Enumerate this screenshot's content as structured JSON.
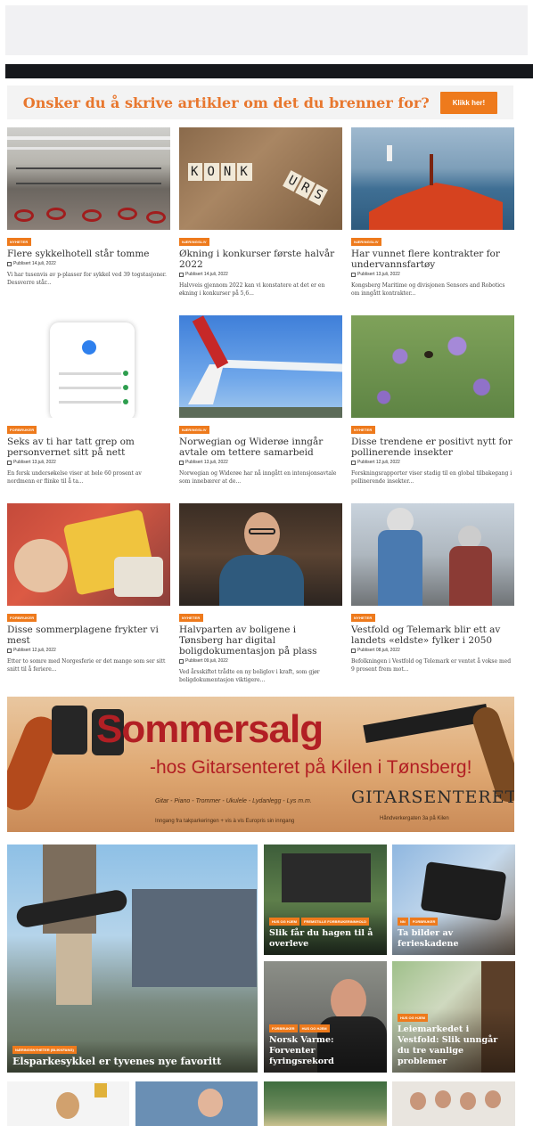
{
  "banner": {
    "text": "Onsker du å skrive artikler om det du brenner for?",
    "button": "Klikk her!"
  },
  "articles": [
    {
      "tag": "NYHETER",
      "title": "Flere sykkelhotell står tomme",
      "date": "Publisert 14.juli, 2022",
      "excerpt": "Vi har tusenvis av p-plasser for sykkel ved 39 togstasjoner. Dessverre står..."
    },
    {
      "tag": "NÆRINGSLIV",
      "title": "Økning i konkurser første halvår 2022",
      "date": "Publisert 14.juli, 2022",
      "excerpt": "Halvveis gjennom 2022 kan vi konstatere at det er en økning i konkurser på 5,6..."
    },
    {
      "tag": "NÆRINGSLIV",
      "title": "Har vunnet flere kontrakter for undervannsfartøy",
      "date": "Publisert 13.juli, 2022",
      "excerpt": "Kongsberg Maritime og divisjonen Sensors and Robotics om inngått kontrakter..."
    },
    {
      "tag": "FORBRUKER",
      "title": "Seks av ti har tatt grep om personvernet sitt på nett",
      "date": "Publisert 13.juli, 2022",
      "excerpt": "En fersk undersøkelse viser at hele 60 prosent av nordmenn er flinke til å ta..."
    },
    {
      "tag": "NÆRINGSLIV",
      "title": "Norwegian og Widerøe inngår avtale om tettere samarbeid",
      "date": "Publisert 13.juli, 2022",
      "excerpt": "Norwegian og Widerøe har nå inngått en intensjonsavtale som innebærer at de..."
    },
    {
      "tag": "NYHETER",
      "title": "Disse trendene er positivt nytt for pollinerende insekter",
      "date": "Publisert 12.juli, 2022",
      "excerpt": "Forskningsrapporter viser stadig til en global tilbakegang i pollinerende insekter..."
    },
    {
      "tag": "FORBRUKER",
      "title": "Disse sommerplagene frykter vi mest",
      "date": "Publisert 12.juli, 2022",
      "excerpt": "Etter to somre med Norgesferie er det mange som ser sitt snitt til å feriere..."
    },
    {
      "tag": "NYHETER",
      "title": "Halvparten av boligene i Tønsberg har digital boligdokumentasjon på plass",
      "date": "Publisert 09.juli, 2022",
      "excerpt": "Ved årsskiftet trådte en ny boliglov i kraft, som gjør boligdokumentasjon viktigere..."
    },
    {
      "tag": "NYHETER",
      "title": "Vestfold og Telemark blir ett av landets «eldste» fylker i 2050",
      "date": "Publisert 08.juli, 2022",
      "excerpt": "Befolkningen i Vestfold og Telemark er ventet å vokse med 9 prosent frem mot..."
    }
  ],
  "ad": {
    "title": "Sommersalg",
    "subtitle": "-hos Gitarsenteret på Kilen i Tønsberg!",
    "items": "Gitar - Piano - Trommer - Ukulele - Lydanlegg - Lys m.m.",
    "note": "Inngang fra takparkeringen + vis à vis Europris sin inngang",
    "logo": "GITARSENTERET",
    "address": "Håndverkergaten 3a på Kilen"
  },
  "featured": [
    {
      "tags": [
        "NÆRINGSNYHETER (BLIKKFANG)"
      ],
      "title": "Elsparkesykkel er tyvenes nye favoritt"
    },
    {
      "tags": [
        "HUS OG HJEM",
        "FREMSTILLE FORBRUKERINNHOLD"
      ],
      "title": "Slik får du hagen til å overleve"
    },
    {
      "tags": [
        "NN",
        "FORBRUKER"
      ],
      "title": "Ta bilder av ferieskadene"
    },
    {
      "tags": [
        "FORBRUKER",
        "HUS OG HJEM"
      ],
      "title": "Norsk Varme: Forventer fyringsrekord"
    },
    {
      "tags": [
        "HUS OG HJEM"
      ],
      "title": "Leiemarkedet i Vestfold: Slik unngår du tre vanlige problemer"
    }
  ]
}
